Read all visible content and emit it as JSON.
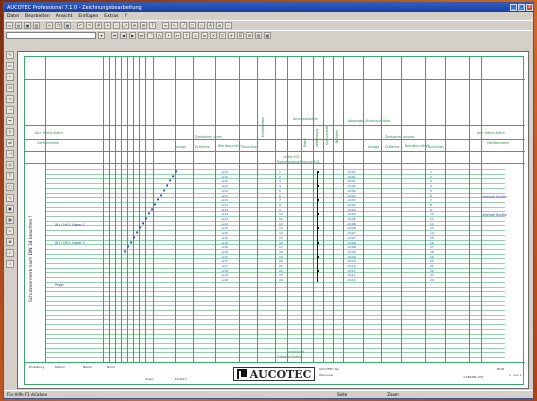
{
  "window": {
    "title": "AUCOTEC Professional 7.1.0 - Zeichnungsbearbeitung",
    "controls": [
      "_",
      "□",
      "x"
    ]
  },
  "menu": [
    "Datei",
    "Bearbeiten",
    "Ansicht",
    "Einfügen",
    "Extras",
    "?"
  ],
  "toolbar1_icons": [
    "new-icon",
    "open-icon",
    "save-icon",
    "print-icon",
    "cut-icon",
    "copy-icon",
    "paste-icon",
    "undo-icon",
    "redo-icon",
    "grid-icon",
    "zoom-in-icon",
    "zoom-out-icon",
    "zoom-fit-icon",
    "refresh-icon",
    "settings-icon",
    "help-icon"
  ],
  "toolbar2": {
    "combo_value": ""
  },
  "sheet": {
    "headers": {
      "anschlussplan": "Anschlusspläne",
      "angaben_stromlauf": "Abgelegte Stromlaufpläne",
      "zielsachen_innen": "Zielsachen innen",
      "zielsachen_aussen": "Zielsachen aussen",
      "anz_fremd": "Anz. fremd Adern",
      "geraetename": "Gerätenname",
      "anlage": "Anlage",
      "ortkennz": "Ortkennz.",
      "betriebsmittel": "Betriebs-mittel",
      "anschluss": "Anschluss",
      "klemmleiste": "Klemmleiste",
      "kabel": "Kabel",
      "verbindung": "Verbindung",
      "querverweis": "Querverweis",
      "br": "Brücken",
      "leiste": "Leiste   102",
      "leiste_sub": "Klemmenbezeichnung   102",
      "schutzvermerk": "Schutzvermerk nach DIN 34 beachten !",
      "fuss1": "Außenblatt",
      "fuss2": "Fußzeile Einheit"
    },
    "left_labels": [
      "W1 / Fe11  Geber 1",
      "W1 / Fe11  Geber 2",
      "Pegel"
    ],
    "rows_left": [
      "1",
      "2",
      "3",
      "4",
      "5",
      "6",
      "7",
      "8",
      "9",
      "10",
      "11",
      "12",
      "13",
      "14",
      "15",
      "16",
      "17",
      "18",
      "19",
      "20",
      "21",
      "22",
      "23",
      "24"
    ],
    "terminals": [
      "1",
      "2",
      "3",
      "4",
      "5",
      "6",
      "7",
      "8",
      "9",
      "10",
      "11",
      "12",
      "13",
      "14",
      "15",
      "16",
      "17",
      "18",
      "19",
      "20",
      "21",
      "22",
      "23",
      "24",
      "25",
      "26",
      "27",
      "28",
      "29",
      "30"
    ],
    "inner_refs": [
      "-A12",
      "-A12",
      "-A12",
      "-A12",
      "-A13",
      "-A13",
      "-A13",
      "-A13",
      "-A14",
      "-A14",
      "-A14",
      "-A14",
      "-A15",
      "-A15",
      "-A15",
      "-A16",
      "-A16",
      "-A16",
      "-A17",
      "-A17",
      "-A17",
      "-A18",
      "-A18",
      "-A18"
    ],
    "outer_refs": [
      "-X101",
      "-X101",
      "-X101",
      "-X102",
      "-X102",
      "-X103",
      "-X103",
      "-X104",
      "-X104",
      "-X105",
      "-X105",
      "-X106",
      "-X106",
      "-X107",
      "-X107",
      "-X108",
      "-X108",
      "-X109",
      "-X109",
      "-X110",
      "-X110",
      "-X111",
      "-X111",
      "-X112"
    ],
    "right_names": [
      "Leitende Geräte",
      "Leitende Geräte"
    ],
    "title_block": {
      "erstellung": "Erstellung",
      "datum": "Datum",
      "name": "Name",
      "norm": "Norm",
      "urspr": "Urspr.",
      "ersatz": "Ersatz f.",
      "logo": "AUCOTEC",
      "company_line1": "AUCOTEC AG",
      "company_line2": "Hannover",
      "page_label": "Blatt",
      "page_value": "1",
      "page_total": "von 1",
      "doc_no": "=AB1KEL-XT1"
    }
  },
  "statusbar": {
    "left": "Für Hilfe F1 drücken",
    "mid": "Seite",
    "right": "Zoom"
  }
}
